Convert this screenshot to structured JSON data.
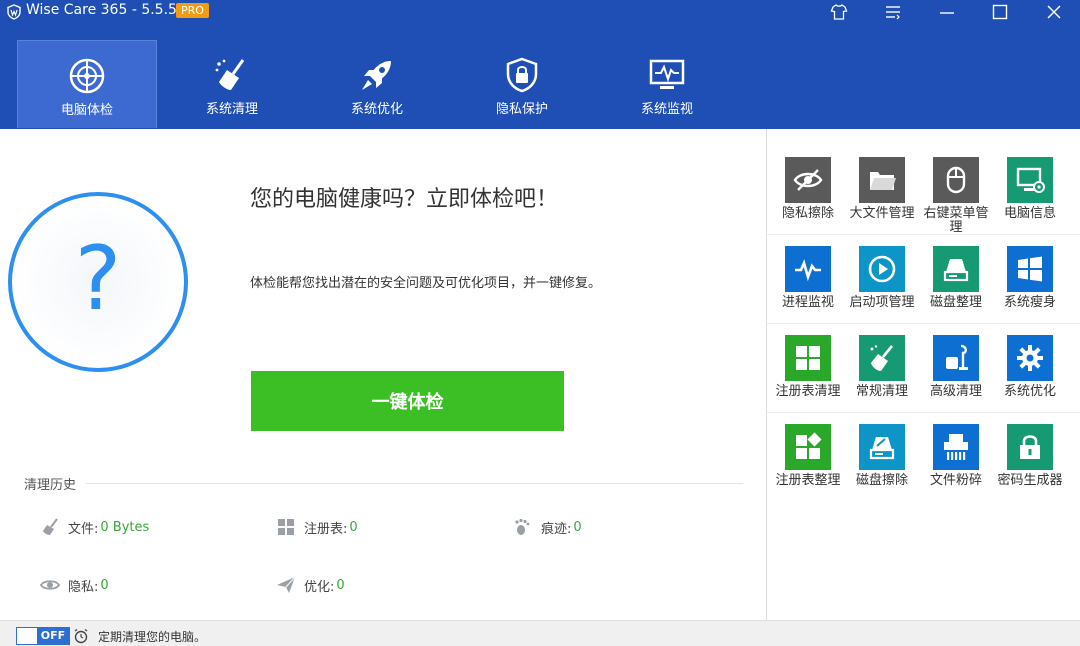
{
  "app": {
    "title": "Wise Care 365 - 5.5.5",
    "badge": "PRO"
  },
  "window_controls": [
    "skin-icon",
    "menu-icon",
    "minimize-icon",
    "maximize-icon",
    "close-icon"
  ],
  "nav": {
    "tabs": [
      {
        "label": "电脑体检",
        "icon": "health-check-icon",
        "active": true
      },
      {
        "label": "系统清理",
        "icon": "broom-icon",
        "active": false
      },
      {
        "label": "系统优化",
        "icon": "rocket-icon",
        "active": false
      },
      {
        "label": "隐私保护",
        "icon": "shield-lock-icon",
        "active": false
      },
      {
        "label": "系统监视",
        "icon": "monitor-icon",
        "active": false
      }
    ]
  },
  "main": {
    "headline": "您的电脑健康吗？立即体检吧！",
    "subtext": "体检能帮您找出潜在的安全问题及可优化项目，并一键修复。",
    "scan_button": "一键体检",
    "circle_glyph": "?"
  },
  "history": {
    "title": "清理历史",
    "items": [
      {
        "label": "文件:",
        "value": "0 Bytes",
        "icon": "broom-icon"
      },
      {
        "label": "注册表:",
        "value": "0",
        "icon": "registry-icon"
      },
      {
        "label": "痕迹:",
        "value": "0",
        "icon": "footprint-icon"
      },
      {
        "label": "隐私:",
        "value": "0",
        "icon": "eye-icon"
      },
      {
        "label": "优化:",
        "value": "0",
        "icon": "paper-plane-icon"
      }
    ]
  },
  "tools": [
    {
      "label": "隐私擦除",
      "icon": "privacy-eraser-icon",
      "color": "#5a5a5a"
    },
    {
      "label": "大文件管理",
      "icon": "folder-icon",
      "color": "#5a5a5a"
    },
    {
      "label": "右键菜单管理",
      "icon": "mouse-icon",
      "color": "#5a5a5a"
    },
    {
      "label": "电脑信息",
      "icon": "computer-info-icon",
      "color": "#159a73"
    },
    {
      "label": "进程监视",
      "icon": "process-monitor-icon",
      "color": "#0d6fd1"
    },
    {
      "label": "启动项管理",
      "icon": "play-icon",
      "color": "#0e95c8"
    },
    {
      "label": "磁盘整理",
      "icon": "disk-defrag-icon",
      "color": "#159a73"
    },
    {
      "label": "系统瘦身",
      "icon": "windows-icon",
      "color": "#0d6fd1"
    },
    {
      "label": "注册表清理",
      "icon": "registry-clean-icon",
      "color": "#2aa82a"
    },
    {
      "label": "常规清理",
      "icon": "broom-icon",
      "color": "#159a73"
    },
    {
      "label": "高级清理",
      "icon": "vacuum-icon",
      "color": "#0d6fd1"
    },
    {
      "label": "系统优化",
      "icon": "gear-icon",
      "color": "#0d6fd1"
    },
    {
      "label": "注册表整理",
      "icon": "registry-defrag-icon",
      "color": "#2aa82a"
    },
    {
      "label": "磁盘擦除",
      "icon": "disk-eraser-icon",
      "color": "#0e95c8"
    },
    {
      "label": "文件粉碎",
      "icon": "shredder-icon",
      "color": "#0d6fd1"
    },
    {
      "label": "密码生成器",
      "icon": "padlock-icon",
      "color": "#159a73"
    }
  ],
  "footer": {
    "toggle_state": "OFF",
    "text": "定期清理您的电脑。"
  },
  "colors": {
    "header": "#1f4fb4",
    "accent": "#2d8ff0",
    "scan_button": "#3cbf25",
    "value_green": "#3aa63a"
  }
}
